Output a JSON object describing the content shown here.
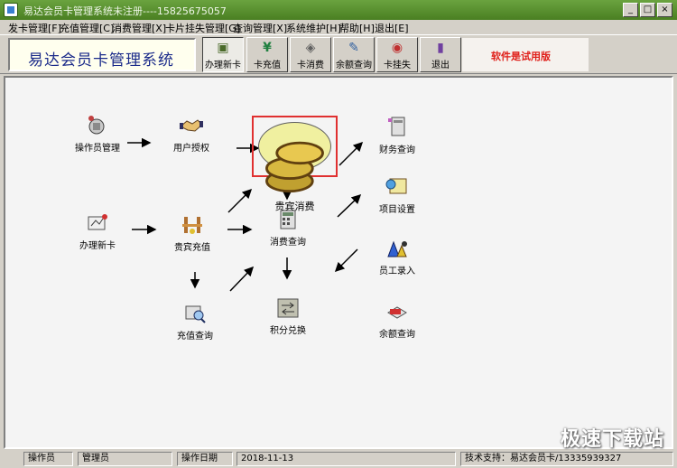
{
  "window": {
    "title": "易达会员卡管理系统未注册----15825675057",
    "minimize": "_",
    "maximize": "□",
    "close": "×"
  },
  "menu": [
    "发卡管理[F]",
    "充值管理[C]",
    "消费管理[X]",
    "卡片挂失管理[G]",
    "查询管理[X]",
    "系统维护[H]",
    "帮助[H]",
    "退出[E]"
  ],
  "toolbar": {
    "logo": "易达会员卡管理系统",
    "buttons": [
      {
        "label": "办理新卡",
        "icon": "new-card-icon",
        "glyph": "▣"
      },
      {
        "label": "卡充值",
        "icon": "yen-icon",
        "glyph": "¥"
      },
      {
        "label": "卡消费",
        "icon": "card-consume-icon",
        "glyph": "◈"
      },
      {
        "label": "余额查询",
        "icon": "balance-query-icon",
        "glyph": "✎"
      },
      {
        "label": "卡挂失",
        "icon": "lost-card-icon",
        "glyph": "◉"
      },
      {
        "label": "退出",
        "icon": "exit-icon",
        "glyph": "▮"
      }
    ],
    "trial_notice": "软件是试用版"
  },
  "flow": {
    "operator_mgmt": "操作员管理",
    "user_auth": "用户授权",
    "vip_consume": "贵宾消费",
    "finance_query": "财务查询",
    "new_card": "办理新卡",
    "vip_recharge": "贵宾充值",
    "consume_query": "消费查询",
    "item_settings": "项目设置",
    "staff_entry": "员工录入",
    "recharge_query": "充值查询",
    "points_exchange": "积分兑换",
    "balance_query": "余额查询"
  },
  "statusbar": {
    "operator_label": "操作员",
    "operator_value": "管理员",
    "date_label": "操作日期",
    "date_value": "2018-11-13",
    "support": "技术支持：易达会员卡/13335939327"
  },
  "watermark": "极速下载站",
  "colors": {
    "titlebar": "#4a7f22",
    "oval_fill": "#f0f0a0",
    "focus_border": "#e03030",
    "trial_text": "#e0201a",
    "logo_text": "#1b2b8a"
  }
}
